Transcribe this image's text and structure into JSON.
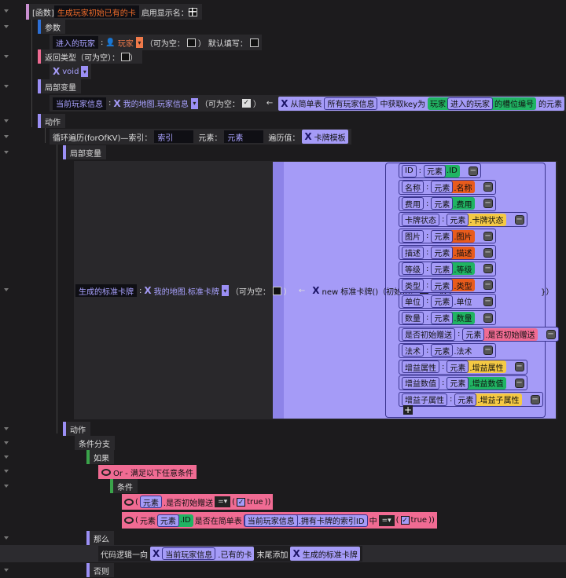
{
  "function": {
    "tag": "[函数]",
    "name": "生成玩家初始已有的卡",
    "show_name_label": "启用显示名：",
    "add": "+"
  },
  "params": {
    "label": "参数",
    "param_name": "进入的玩家",
    "type": "玩家",
    "nullable": "（可为空：",
    "nullable_end": "）",
    "default_label": "默认填写："
  },
  "return": {
    "label": "返回类型（可为空）：",
    "end": "）",
    "type": "void"
  },
  "locals": {
    "label": "局部变量",
    "var_name": "当前玩家信息",
    "type": "我的地图.玩家信息",
    "nullable": "（可为空：",
    "nullable_end": "）",
    "arrow": "←",
    "from_table": "从简单表",
    "table": "所有玩家信息",
    "get_key": "中获取key为",
    "player": "玩家",
    "player_var": "进入的玩家",
    "slot": "的槽位编号",
    "element_of": "的元素"
  },
  "actions": {
    "label": "动作",
    "loop": {
      "label": "循环遍历(forOfKV)—索引：",
      "index": "索引",
      "elem_label": "元素：",
      "elem": "元素",
      "iter_label": "遍历值：",
      "iter": "卡牌模板"
    },
    "loop_locals": {
      "label": "局部变量",
      "var_name": "生成的标准卡牌",
      "type": "我的地图.标准卡牌",
      "nullable": "（可为空：",
      "nullable_end": "）",
      "arrow": "←",
      "new_label": "new 标准卡牌()（初始化：",
      "arrow2": "←",
      "table_open": "表{",
      "table_close": "}）",
      "fields": [
        {
          "key": "ID",
          "obj": "元素",
          "prop": ".ID",
          "color": "green"
        },
        {
          "key": "名称",
          "obj": "元素",
          "prop": ".名称",
          "color": "orange"
        },
        {
          "key": "费用",
          "obj": "元素",
          "prop": ".费用",
          "color": "green"
        },
        {
          "key": "卡牌状态",
          "obj": "元素",
          "prop": ".卡牌状态",
          "color": "yellow"
        },
        {
          "key": "图片",
          "obj": "元素",
          "prop": ".图片",
          "color": "orange"
        },
        {
          "key": "描述",
          "obj": "元素",
          "prop": ".描述",
          "color": "orange"
        },
        {
          "key": "等级",
          "obj": "元素",
          "prop": ".等级",
          "color": "green"
        },
        {
          "key": "类型",
          "obj": "元素",
          "prop": ".类型",
          "color": "orange"
        },
        {
          "key": "单位",
          "obj": "元素",
          "prop": ".单位",
          "color": "lav"
        },
        {
          "key": "数量",
          "obj": "元素",
          "prop": ".数量",
          "color": "green"
        },
        {
          "key": "是否初始赠送",
          "obj": "元素",
          "prop": ".是否初始赠送",
          "color": "pink"
        },
        {
          "key": "法术",
          "obj": "元素",
          "prop": ".法术",
          "color": "lav"
        },
        {
          "key": "增益属性",
          "obj": "元素",
          "prop": ".增益属性",
          "color": "yellow"
        },
        {
          "key": "增益数值",
          "obj": "元素",
          "prop": ".增益数值",
          "color": "green"
        },
        {
          "key": "增益子属性",
          "obj": "元素",
          "prop": ".增益子属性",
          "color": "yellow"
        }
      ],
      "add": "+"
    },
    "inner_actions": {
      "label": "动作",
      "branch": "条件分支",
      "if": "如果",
      "or": "Or - 满足以下任意条件",
      "cond_label": "条件",
      "cond1": {
        "obj": "元素",
        "prop": ".是否初始赠送",
        "op": "=▾",
        "value": "true"
      },
      "cond2": {
        "obj": "元素",
        "obj2": "元素",
        "prop": ".ID",
        "in_table": "是否在简单表",
        "table_obj": "当前玩家信息",
        "table_prop": ".拥有卡牌的索引ID",
        "in": "中",
        "op": "=▾",
        "value": "true"
      },
      "then": "那么",
      "code": {
        "prefix": "代码逻辑一向",
        "obj": "当前玩家信息",
        "prop": ".已有的卡",
        "append": "末尾添加",
        "item": "生成的标准卡牌"
      },
      "else": "否则"
    }
  }
}
